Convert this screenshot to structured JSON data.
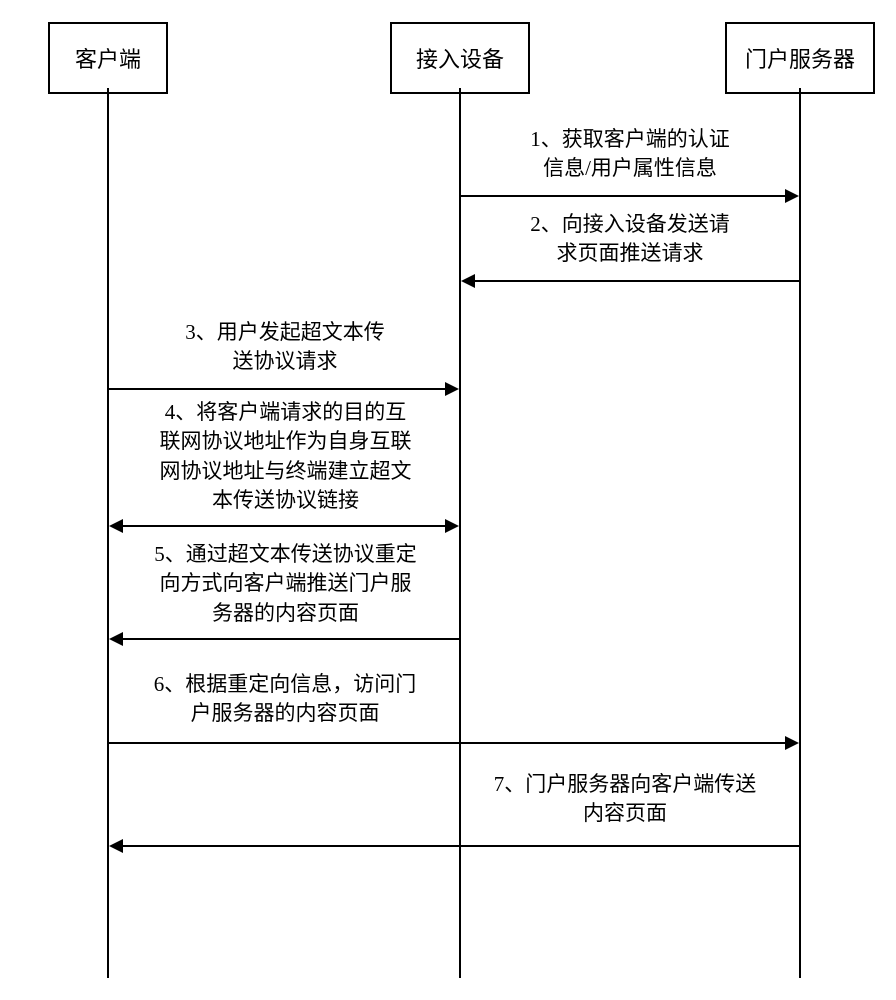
{
  "participants": {
    "client": "客户端",
    "access_device": "接入设备",
    "portal_server": "门户服务器"
  },
  "messages": {
    "m1": "1、获取客户端的认证\n信息/用户属性信息",
    "m2": "2、向接入设备发送请\n求页面推送请求",
    "m3": "3、用户发起超文本传\n送协议请求",
    "m4": "4、将客户端请求的目的互\n联网协议地址作为自身互联\n网协议地址与终端建立超文\n本传送协议链接",
    "m5": "5、通过超文本传送协议重定\n向方式向客户端推送门户服\n务器的内容页面",
    "m6": "6、根据重定向信息，访问门\n户服务器的内容页面",
    "m7": "7、门户服务器向客户端传送\n内容页面"
  }
}
